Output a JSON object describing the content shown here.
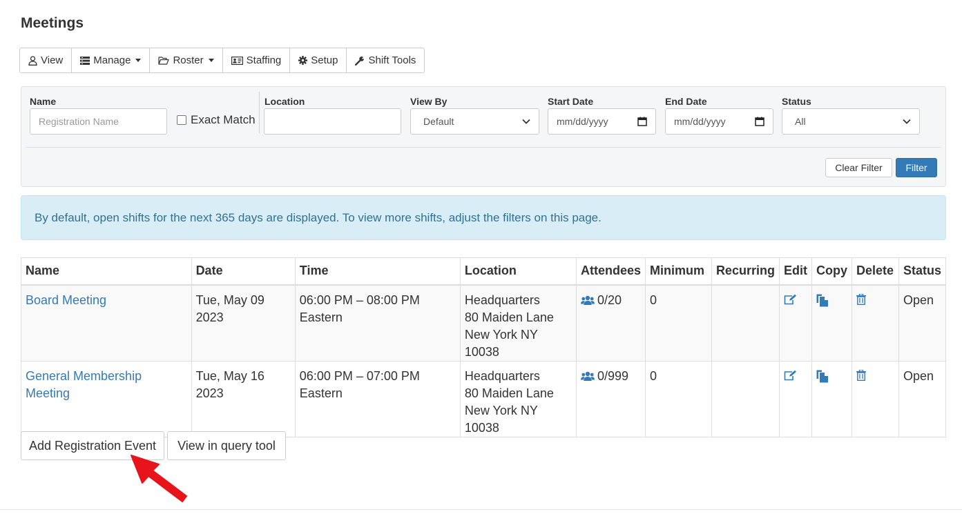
{
  "page": {
    "title": "Meetings"
  },
  "toolbar": {
    "view": "View",
    "manage": "Manage",
    "roster": "Roster",
    "staffing": "Staffing",
    "setup": "Setup",
    "shift_tools": "Shift Tools"
  },
  "filters": {
    "name_label": "Name",
    "name_placeholder": "Registration Name",
    "exact_match_label": "Exact Match",
    "location_label": "Location",
    "location_value": "",
    "view_by_label": "View By",
    "view_by_value": "Default",
    "start_date_label": "Start Date",
    "start_date_placeholder": "mm/dd/yyyy",
    "end_date_label": "End Date",
    "end_date_placeholder": "mm/dd/yyyy",
    "status_label": "Status",
    "status_value": "All",
    "clear_button": "Clear Filter",
    "filter_button": "Filter"
  },
  "alert": {
    "text": "By default, open shifts for the next 365 days are displayed. To view more shifts, adjust the filters on this page."
  },
  "table": {
    "headers": [
      "Name",
      "Date",
      "Time",
      "Location",
      "Attendees",
      "Minimum",
      "Recurring",
      "Edit",
      "Copy",
      "Delete",
      "Status"
    ],
    "rows": [
      {
        "name": "Board Meeting",
        "date": "Tue, May 09 2023",
        "time": "06:00 PM – 08:00 PM Eastern",
        "location_line1": "Headquarters",
        "location_line2": "80 Maiden Lane",
        "location_line3": "New York NY 10038",
        "attendees": "0/20",
        "minimum": "0",
        "recurring": "",
        "status": "Open"
      },
      {
        "name": "General Membership Meeting",
        "date": "Tue, May 16 2023",
        "time": "06:00 PM – 07:00 PM Eastern",
        "location_line1": "Headquarters",
        "location_line2": "80 Maiden Lane",
        "location_line3": "New York NY 10038",
        "attendees": "0/999",
        "minimum": "0",
        "recurring": "",
        "status": "Open"
      }
    ]
  },
  "actions": {
    "add_registration": "Add Registration Event",
    "view_query": "View in query tool"
  },
  "icons": {
    "attendees": "users-icon",
    "edit": "edit-icon",
    "copy": "copy-icon",
    "delete": "trash-icon",
    "pointer": "red-arrow-icon"
  },
  "colors": {
    "link": "#337ab7",
    "primary_button": "#337ab7",
    "alert_bg": "#d9edf7",
    "alert_text": "#31708f",
    "arrow": "#e8141b"
  }
}
